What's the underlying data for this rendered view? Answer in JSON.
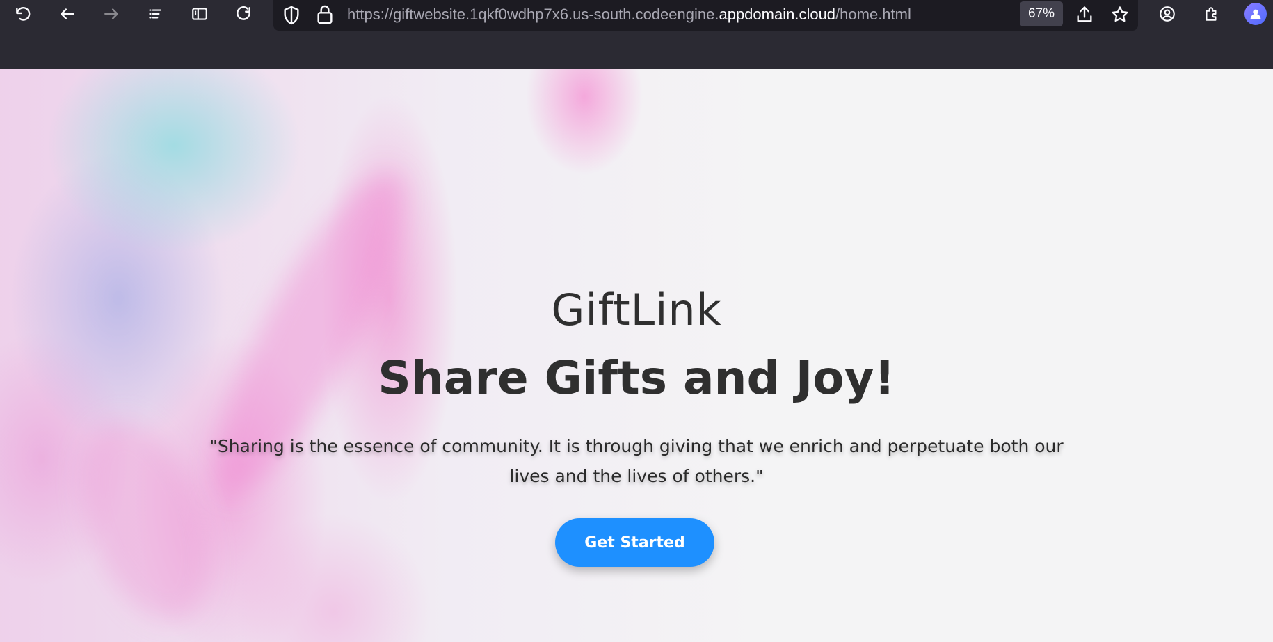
{
  "browser": {
    "url": {
      "prefix": "https://giftwebsite.1qkf0wdhp7x6.us-south.codeengine.",
      "host": "appdomain.cloud",
      "path": "/home.html"
    },
    "zoom": "67%",
    "icons": {
      "undo": "undo-icon",
      "back": "back-arrow-icon",
      "forward": "forward-arrow-icon",
      "list": "list-all-tabs-icon",
      "sidebar": "sidebar-icon",
      "reload": "reload-icon",
      "shield": "tracking-protection-shield-icon",
      "lock": "padlock-icon",
      "share": "share-icon",
      "bookmark": "star-bookmark-icon",
      "account": "account-icon",
      "extensions": "extensions-puzzle-icon",
      "avatar": "profile-avatar-icon"
    },
    "colors": {
      "chrome_bg": "#2b2a33",
      "url_bg": "#1c1b22"
    }
  },
  "hero": {
    "brand": "GiftLink",
    "headline": "Share Gifts and Joy!",
    "quote": "\"Sharing is the essence of community. It is through giving that we enrich and perpetuate both our lives and the lives of others.\"",
    "cta_label": "Get Started",
    "colors": {
      "cta_bg": "#1e90ff",
      "text": "#2f2f2f"
    }
  }
}
